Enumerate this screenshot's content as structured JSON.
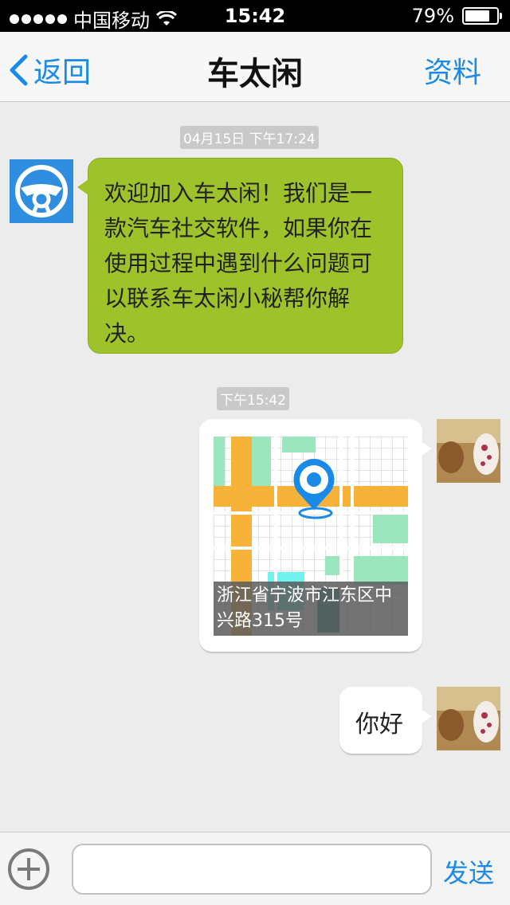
{
  "status_bar": {
    "carrier": "中国移动",
    "time": "15:42",
    "battery": "79%",
    "battery_level": 0.79,
    "signal_icon": "signal-dots-icon",
    "wifi_icon": "wifi-icon",
    "battery_icon": "battery-icon"
  },
  "nav": {
    "back_label": "返回",
    "title": "车太闲",
    "profile_label": "资料"
  },
  "chat": {
    "messages": [
      {
        "timestamp": "04月15日 下午17:24"
      },
      {
        "from": "bot",
        "text": "欢迎加入车太闲！我们是一款汽车社交软件，如果你在使用过程中遇到什么问题可以联系车太闲小秘帮你解决。"
      },
      {
        "timestamp": "下午15:42"
      },
      {
        "from": "me",
        "type": "location",
        "caption": "浙江省宁波市江东区中兴路315号"
      },
      {
        "from": "me",
        "type": "text",
        "text": "你好"
      }
    ]
  },
  "bottom": {
    "input_value": "",
    "send_label": "发送"
  },
  "colors": {
    "accent": "#1a8ae8",
    "bot_bubble": "#9dc22a",
    "background": "#ececec"
  }
}
